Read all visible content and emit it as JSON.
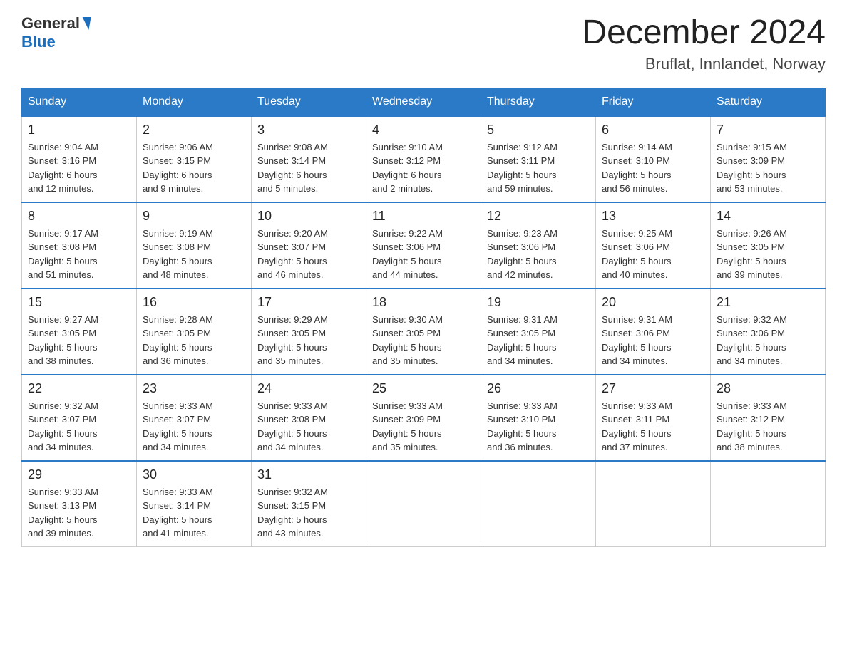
{
  "header": {
    "logo_general": "General",
    "logo_blue": "Blue",
    "month_title": "December 2024",
    "location": "Bruflat, Innlandet, Norway"
  },
  "days_of_week": [
    "Sunday",
    "Monday",
    "Tuesday",
    "Wednesday",
    "Thursday",
    "Friday",
    "Saturday"
  ],
  "weeks": [
    [
      {
        "day": "1",
        "sunrise": "9:04 AM",
        "sunset": "3:16 PM",
        "daylight": "6 hours and 12 minutes."
      },
      {
        "day": "2",
        "sunrise": "9:06 AM",
        "sunset": "3:15 PM",
        "daylight": "6 hours and 9 minutes."
      },
      {
        "day": "3",
        "sunrise": "9:08 AM",
        "sunset": "3:14 PM",
        "daylight": "6 hours and 5 minutes."
      },
      {
        "day": "4",
        "sunrise": "9:10 AM",
        "sunset": "3:12 PM",
        "daylight": "6 hours and 2 minutes."
      },
      {
        "day": "5",
        "sunrise": "9:12 AM",
        "sunset": "3:11 PM",
        "daylight": "5 hours and 59 minutes."
      },
      {
        "day": "6",
        "sunrise": "9:14 AM",
        "sunset": "3:10 PM",
        "daylight": "5 hours and 56 minutes."
      },
      {
        "day": "7",
        "sunrise": "9:15 AM",
        "sunset": "3:09 PM",
        "daylight": "5 hours and 53 minutes."
      }
    ],
    [
      {
        "day": "8",
        "sunrise": "9:17 AM",
        "sunset": "3:08 PM",
        "daylight": "5 hours and 51 minutes."
      },
      {
        "day": "9",
        "sunrise": "9:19 AM",
        "sunset": "3:08 PM",
        "daylight": "5 hours and 48 minutes."
      },
      {
        "day": "10",
        "sunrise": "9:20 AM",
        "sunset": "3:07 PM",
        "daylight": "5 hours and 46 minutes."
      },
      {
        "day": "11",
        "sunrise": "9:22 AM",
        "sunset": "3:06 PM",
        "daylight": "5 hours and 44 minutes."
      },
      {
        "day": "12",
        "sunrise": "9:23 AM",
        "sunset": "3:06 PM",
        "daylight": "5 hours and 42 minutes."
      },
      {
        "day": "13",
        "sunrise": "9:25 AM",
        "sunset": "3:06 PM",
        "daylight": "5 hours and 40 minutes."
      },
      {
        "day": "14",
        "sunrise": "9:26 AM",
        "sunset": "3:05 PM",
        "daylight": "5 hours and 39 minutes."
      }
    ],
    [
      {
        "day": "15",
        "sunrise": "9:27 AM",
        "sunset": "3:05 PM",
        "daylight": "5 hours and 38 minutes."
      },
      {
        "day": "16",
        "sunrise": "9:28 AM",
        "sunset": "3:05 PM",
        "daylight": "5 hours and 36 minutes."
      },
      {
        "day": "17",
        "sunrise": "9:29 AM",
        "sunset": "3:05 PM",
        "daylight": "5 hours and 35 minutes."
      },
      {
        "day": "18",
        "sunrise": "9:30 AM",
        "sunset": "3:05 PM",
        "daylight": "5 hours and 35 minutes."
      },
      {
        "day": "19",
        "sunrise": "9:31 AM",
        "sunset": "3:05 PM",
        "daylight": "5 hours and 34 minutes."
      },
      {
        "day": "20",
        "sunrise": "9:31 AM",
        "sunset": "3:06 PM",
        "daylight": "5 hours and 34 minutes."
      },
      {
        "day": "21",
        "sunrise": "9:32 AM",
        "sunset": "3:06 PM",
        "daylight": "5 hours and 34 minutes."
      }
    ],
    [
      {
        "day": "22",
        "sunrise": "9:32 AM",
        "sunset": "3:07 PM",
        "daylight": "5 hours and 34 minutes."
      },
      {
        "day": "23",
        "sunrise": "9:33 AM",
        "sunset": "3:07 PM",
        "daylight": "5 hours and 34 minutes."
      },
      {
        "day": "24",
        "sunrise": "9:33 AM",
        "sunset": "3:08 PM",
        "daylight": "5 hours and 34 minutes."
      },
      {
        "day": "25",
        "sunrise": "9:33 AM",
        "sunset": "3:09 PM",
        "daylight": "5 hours and 35 minutes."
      },
      {
        "day": "26",
        "sunrise": "9:33 AM",
        "sunset": "3:10 PM",
        "daylight": "5 hours and 36 minutes."
      },
      {
        "day": "27",
        "sunrise": "9:33 AM",
        "sunset": "3:11 PM",
        "daylight": "5 hours and 37 minutes."
      },
      {
        "day": "28",
        "sunrise": "9:33 AM",
        "sunset": "3:12 PM",
        "daylight": "5 hours and 38 minutes."
      }
    ],
    [
      {
        "day": "29",
        "sunrise": "9:33 AM",
        "sunset": "3:13 PM",
        "daylight": "5 hours and 39 minutes."
      },
      {
        "day": "30",
        "sunrise": "9:33 AM",
        "sunset": "3:14 PM",
        "daylight": "5 hours and 41 minutes."
      },
      {
        "day": "31",
        "sunrise": "9:32 AM",
        "sunset": "3:15 PM",
        "daylight": "5 hours and 43 minutes."
      },
      null,
      null,
      null,
      null
    ]
  ],
  "labels": {
    "sunrise": "Sunrise:",
    "sunset": "Sunset:",
    "daylight": "Daylight:"
  }
}
